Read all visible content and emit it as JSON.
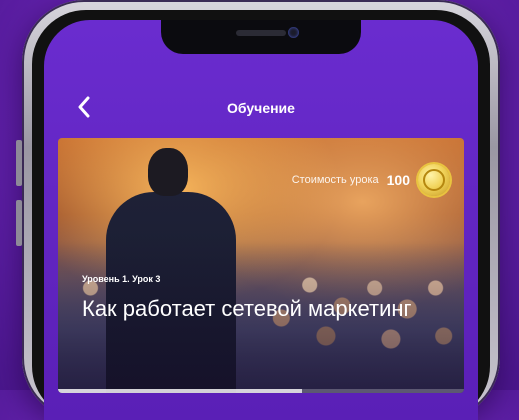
{
  "header": {
    "title": "Обучение",
    "back_icon": "chevron-left-icon"
  },
  "lesson": {
    "price_label": "Стоимость урока",
    "price_value": "100",
    "coin_icon": "coin-icon",
    "meta": "Уровень 1. Урок 3",
    "title": "Как работает сетевой маркетинг"
  },
  "colors": {
    "background": "#6b25b8",
    "screen": "#6a2ccf",
    "coin": "#f1d35a"
  }
}
